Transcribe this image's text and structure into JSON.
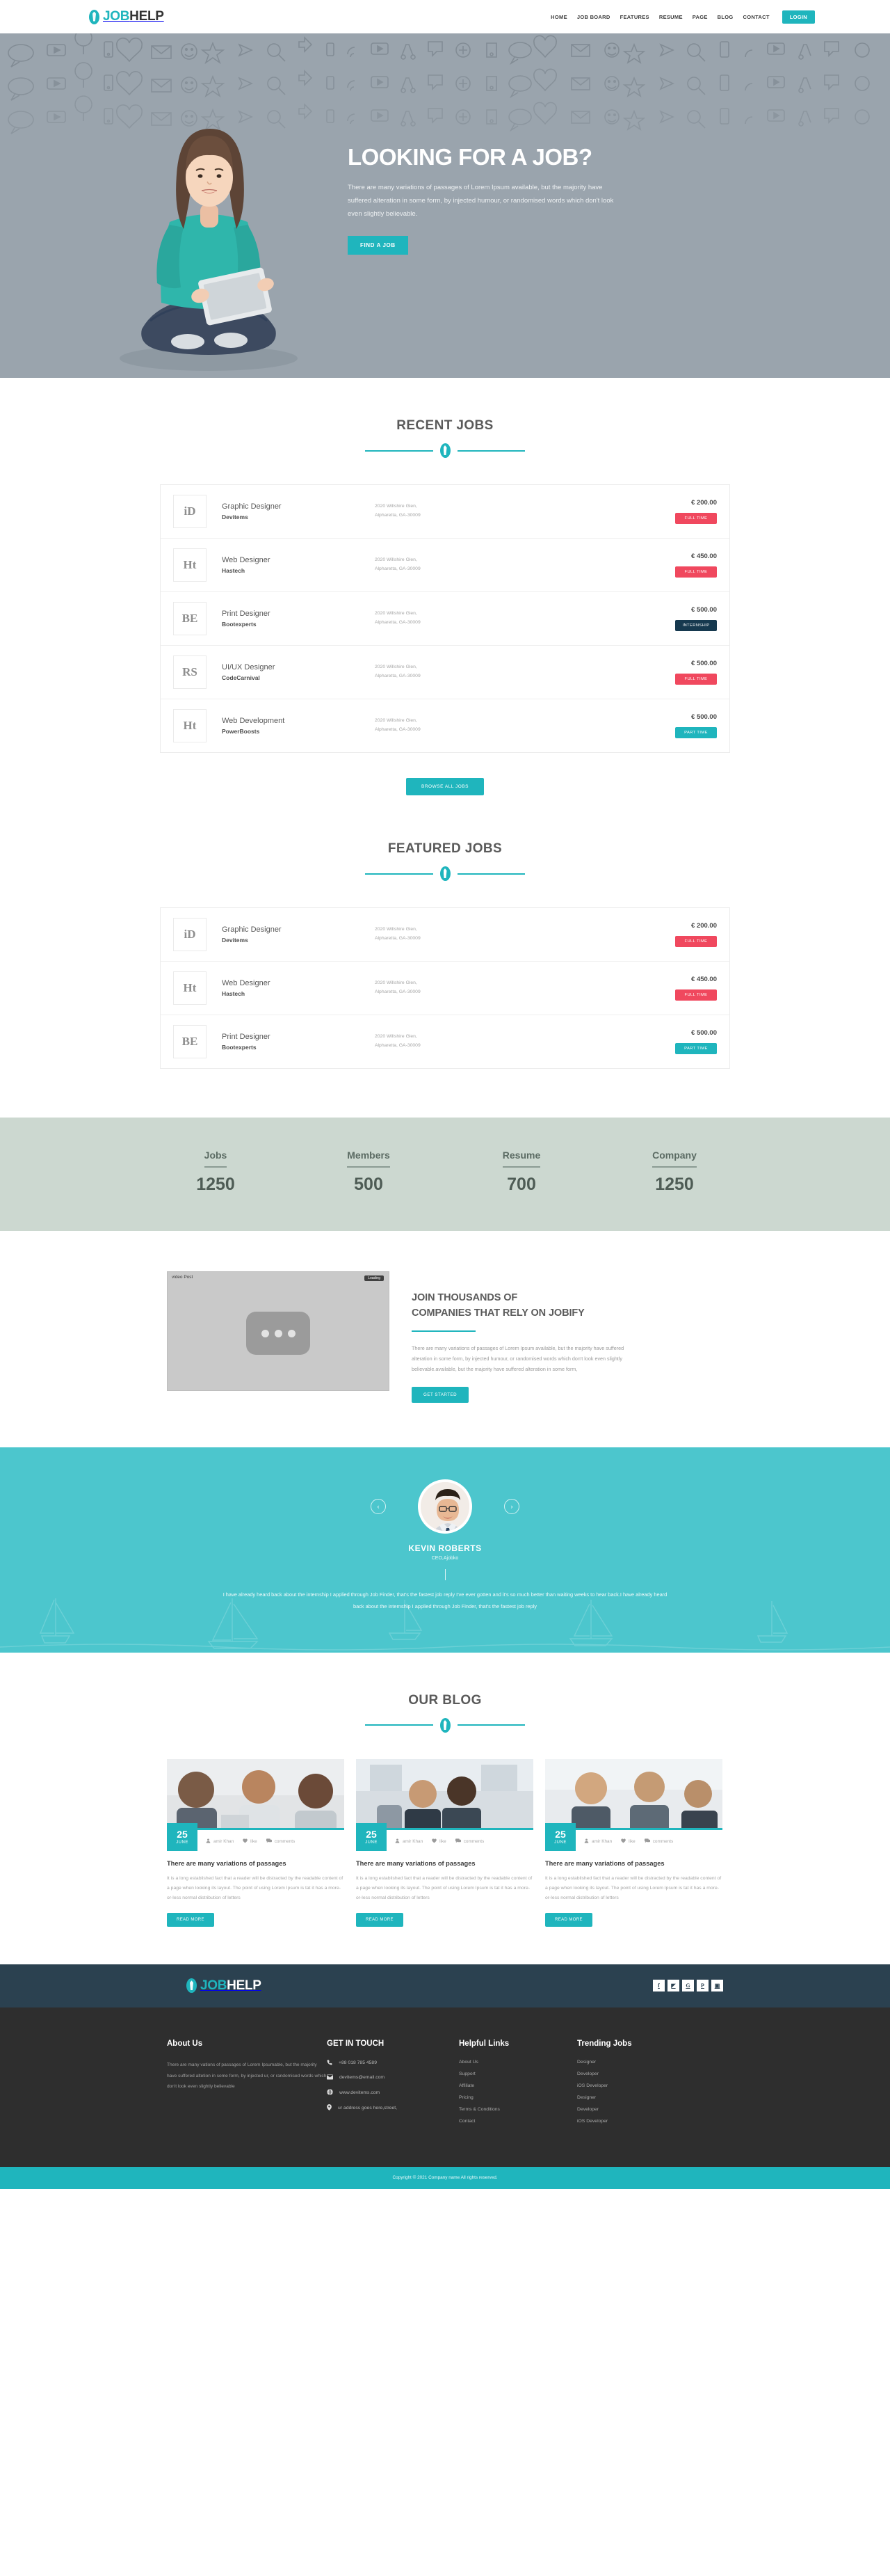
{
  "header": {
    "brand": {
      "part1": "JOB",
      "part2": "HELP",
      "icon": "tie-icon"
    },
    "nav": [
      {
        "label": "HOME"
      },
      {
        "label": "JOB BOARD"
      },
      {
        "label": "FEATURES"
      },
      {
        "label": "RESUME"
      },
      {
        "label": "PAGE"
      },
      {
        "label": "BLOG"
      },
      {
        "label": "CONTACT"
      }
    ],
    "login_label": "LOGIN"
  },
  "hero": {
    "title": "LOOKING FOR A JOB?",
    "subtitle": "There are many variations of passages of Lorem Ipsum available, but the majority have suffered alteration in some form, by injected humour, or randomised words which don't look even slightly believable.",
    "cta_label": "FIND A JOB"
  },
  "recent_jobs": {
    "title": "RECENT JOBS",
    "browse_label": "BROWSE ALL JOBS",
    "rows": [
      {
        "logo": "iD",
        "title": "Graphic Designer",
        "company": "Devitems",
        "address1": "2020 Willshire Glen,",
        "address2": "Alpharetta, GA-30009",
        "price": "€ 200.00",
        "tag": "FULL TIME",
        "tag_type": "full"
      },
      {
        "logo": "Ht",
        "title": "Web Designer",
        "company": "Hastech",
        "address1": "2020 Willshire Glen,",
        "address2": "Alpharetta, GA-30009",
        "price": "€ 450.00",
        "tag": "FULL TIME",
        "tag_type": "full"
      },
      {
        "logo": "BE",
        "title": "Print Designer",
        "company": "Bootexperts",
        "address1": "2020 Willshire Glen,",
        "address2": "Alpharetta, GA-30009",
        "price": "€ 500.00",
        "tag": "INTERNSHIP",
        "tag_type": "intern"
      },
      {
        "logo": "RS",
        "title": "UI/UX Designer",
        "company": "CodeCarnival",
        "address1": "2020 Willshire Glen,",
        "address2": "Alpharetta, GA-30009",
        "price": "€ 500.00",
        "tag": "FULL TIME",
        "tag_type": "full"
      },
      {
        "logo": "Ht",
        "title": "Web Development",
        "company": "PowerBoosts",
        "address1": "2020 Willshire Glen,",
        "address2": "Alpharetta, GA-30009",
        "price": "€ 500.00",
        "tag": "PART TIME",
        "tag_type": "part"
      }
    ]
  },
  "featured_jobs": {
    "title": "FEATURED JOBS",
    "rows": [
      {
        "logo": "iD",
        "title": "Graphic Designer",
        "company": "Devitems",
        "address1": "2020 Willshire Glen,",
        "address2": "Alpharetta, GA-30009",
        "price": "€ 200.00",
        "tag": "FULL TIME",
        "tag_type": "full"
      },
      {
        "logo": "Ht",
        "title": "Web Designer",
        "company": "Hastech",
        "address1": "2020 Willshire Glen,",
        "address2": "Alpharetta, GA-30009",
        "price": "€ 450.00",
        "tag": "FULL TIME",
        "tag_type": "full"
      },
      {
        "logo": "BE",
        "title": "Print Designer",
        "company": "Bootexperts",
        "address1": "2020 Willshire Glen,",
        "address2": "Alpharetta, GA-30009",
        "price": "€ 500.00",
        "tag": "PART TIME",
        "tag_type": "part"
      }
    ]
  },
  "counters": [
    {
      "label": "Jobs",
      "value": "1250"
    },
    {
      "label": "Members",
      "value": "500"
    },
    {
      "label": "Resume",
      "value": "700"
    },
    {
      "label": "Company",
      "value": "1250"
    }
  ],
  "promo": {
    "video_label": "video Post",
    "video_status": "Loading",
    "title_line1": "JOIN THOUSANDS OF",
    "title_line2": "COMPANIES THAT RELY ON JOBIFY",
    "text": "There are many variations of passages of Lorem Ipsum available, but the majority have suffered alteration in some form, by injected humour, or randomised words which don't look even slightly believable.available, but the majority have suffered alteration in some form,",
    "cta_label": "GET STARTED"
  },
  "testimonial": {
    "prev_icon": "chevron-left-icon",
    "next_icon": "chevron-right-icon",
    "name": "KEVIN ROBERTS",
    "role": "CEO,Ajobko",
    "quote": "I have already heard back about the internship I applied through Job Finder, that's the fastest job reply I've ever gotten and it's so much better than waiting weeks to hear back.I have already heard back about the internship I applied through Job Finder, that's the fastest job reply"
  },
  "blog": {
    "title": "OUR BLOG",
    "posts": [
      {
        "day": "25",
        "month": "JUNE",
        "author": "amir Khan",
        "like": "like",
        "comments": "comments",
        "title": "There are many variations of passages",
        "text": "It is a long established fact that a reader will be distracted by the readable content of a page when looking its layout. The point of using Lorem Ipsum is tat it has a more-or-less normal distribution of letters",
        "cta": "READ MORE"
      },
      {
        "day": "25",
        "month": "JUNE",
        "author": "amir Khan",
        "like": "like",
        "comments": "comments",
        "title": "There are many variations of passages",
        "text": "It is a long established fact that a reader will be distracted by the readable content of a page when looking its layout. The point of using Lorem Ipsum is tat it has a more-or-less normal distribution of letters",
        "cta": "READ MORE"
      },
      {
        "day": "25",
        "month": "JUNE",
        "author": "amir Khan",
        "like": "like",
        "comments": "comments",
        "title": "There are many variations of passages",
        "text": "It is a long established fact that a reader will be distracted by the readable content of a page when looking its layout. The point of using Lorem Ipsum is tat it has a more-or-less normal distribution of letters",
        "cta": "READ MORE"
      }
    ]
  },
  "footer": {
    "brand": {
      "part1": "JOB",
      "part2": "HELP"
    },
    "social": [
      {
        "name": "facebook-icon",
        "glyph": "f"
      },
      {
        "name": "rss-icon",
        "glyph": "◤"
      },
      {
        "name": "google-plus-icon",
        "glyph": "G"
      },
      {
        "name": "pinterest-icon",
        "glyph": "P"
      },
      {
        "name": "instagram-icon",
        "glyph": "▣"
      }
    ],
    "about": {
      "heading": "About Us",
      "text": "There are many vations of passages of Lorem Ipsumable, but the majority have suffered altetion in some form, by injected ur, or randomised words which don't look even slightly believable"
    },
    "touch": {
      "heading": "GET IN TOUCH",
      "items": [
        {
          "icon": "phone-icon",
          "text": "+88 018 785 4589"
        },
        {
          "icon": "envelope-icon",
          "text": "devitems@email.com"
        },
        {
          "icon": "globe-icon",
          "text": "www.devitems.com"
        },
        {
          "icon": "map-marker-icon",
          "text": "ur address goes here,street,"
        }
      ]
    },
    "helpful": {
      "heading": "Helpful Links",
      "items": [
        "About Us",
        "Support",
        "Affiliate",
        "Pricing",
        "Terms & Conditions",
        "Contact"
      ]
    },
    "trending": {
      "heading": "Trending Jobs",
      "items": [
        "Designer",
        "Developer",
        "iOS Developer",
        "Designer",
        "Developer",
        "iOS Developer"
      ]
    },
    "copyright": "Copyright © 2021 Company name All rights reserved."
  },
  "colors": {
    "accent": "#1fb5bd",
    "accent_light": "#4cc6cd",
    "danger": "#f0485e",
    "dark": "#16394f",
    "footer_top": "#2b4150",
    "footer_main": "#2e2e2e",
    "counter_bg": "#ccd8d0",
    "hero_bg": "#9aa4ad"
  }
}
